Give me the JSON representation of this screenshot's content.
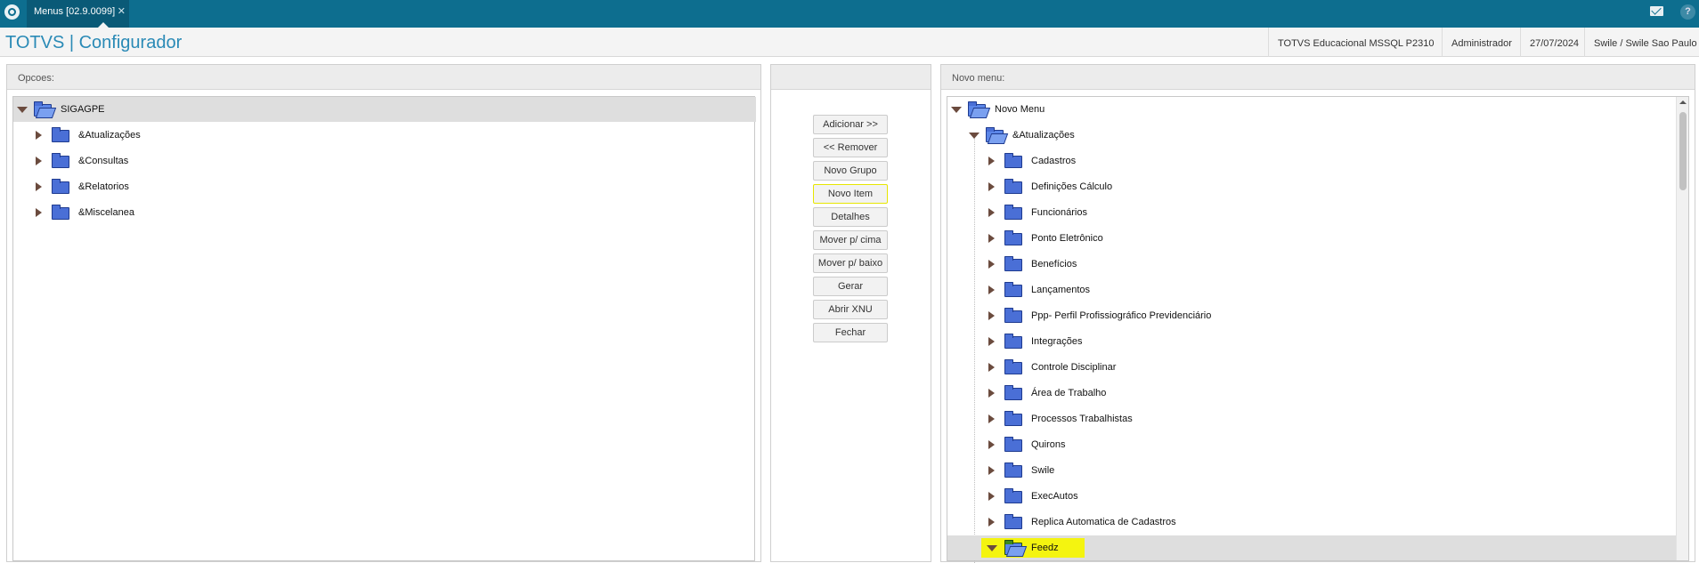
{
  "topbar": {
    "tab_label": "Menus [02.9.0099]",
    "close_glyph": "✕",
    "help_glyph": "?"
  },
  "header": {
    "title": "TOTVS | Configurador",
    "environment": "TOTVS Educacional MSSQL P2310",
    "user": "Administrador",
    "date": "27/07/2024",
    "branch": "Swile / Swile Sao Paulo"
  },
  "left_panel": {
    "title": "Opcoes:",
    "root": "SIGAGPE",
    "children": [
      "&Atualizações",
      "&Consultas",
      "&Relatorios",
      "&Miscelanea"
    ]
  },
  "buttons": {
    "add": "Adicionar >>",
    "remove": "<< Remover",
    "new_group": "Novo Grupo",
    "new_item": "Novo Item",
    "details": "Detalhes",
    "move_up": "Mover p/ cima",
    "move_down": "Mover p/ baixo",
    "generate": "Gerar",
    "open_xnu": "Abrir XNU",
    "close": "Fechar"
  },
  "right_panel": {
    "title": "Novo menu:",
    "root": "Novo Menu",
    "group": "&Atualizações",
    "items": [
      "Cadastros",
      "Definições Cálculo",
      "Funcionários",
      "Ponto Eletrônico",
      "Benefícios",
      "Lançamentos",
      "Ppp- Perfil Profissiográfico Previdenciário",
      "Integrações",
      "Controle Disciplinar",
      "Área de Trabalho",
      "Processos Trabalhistas",
      "Quirons",
      "Swile",
      "ExecAutos",
      "Replica Automatica de Cadastros"
    ],
    "selected": "Feedz"
  },
  "colors": {
    "topbar": "#0d6e8f",
    "title": "#2a8ab6",
    "highlight": "#f4f410",
    "folder": "#4a6fd6",
    "folder_selected": "#3d8a1d"
  }
}
